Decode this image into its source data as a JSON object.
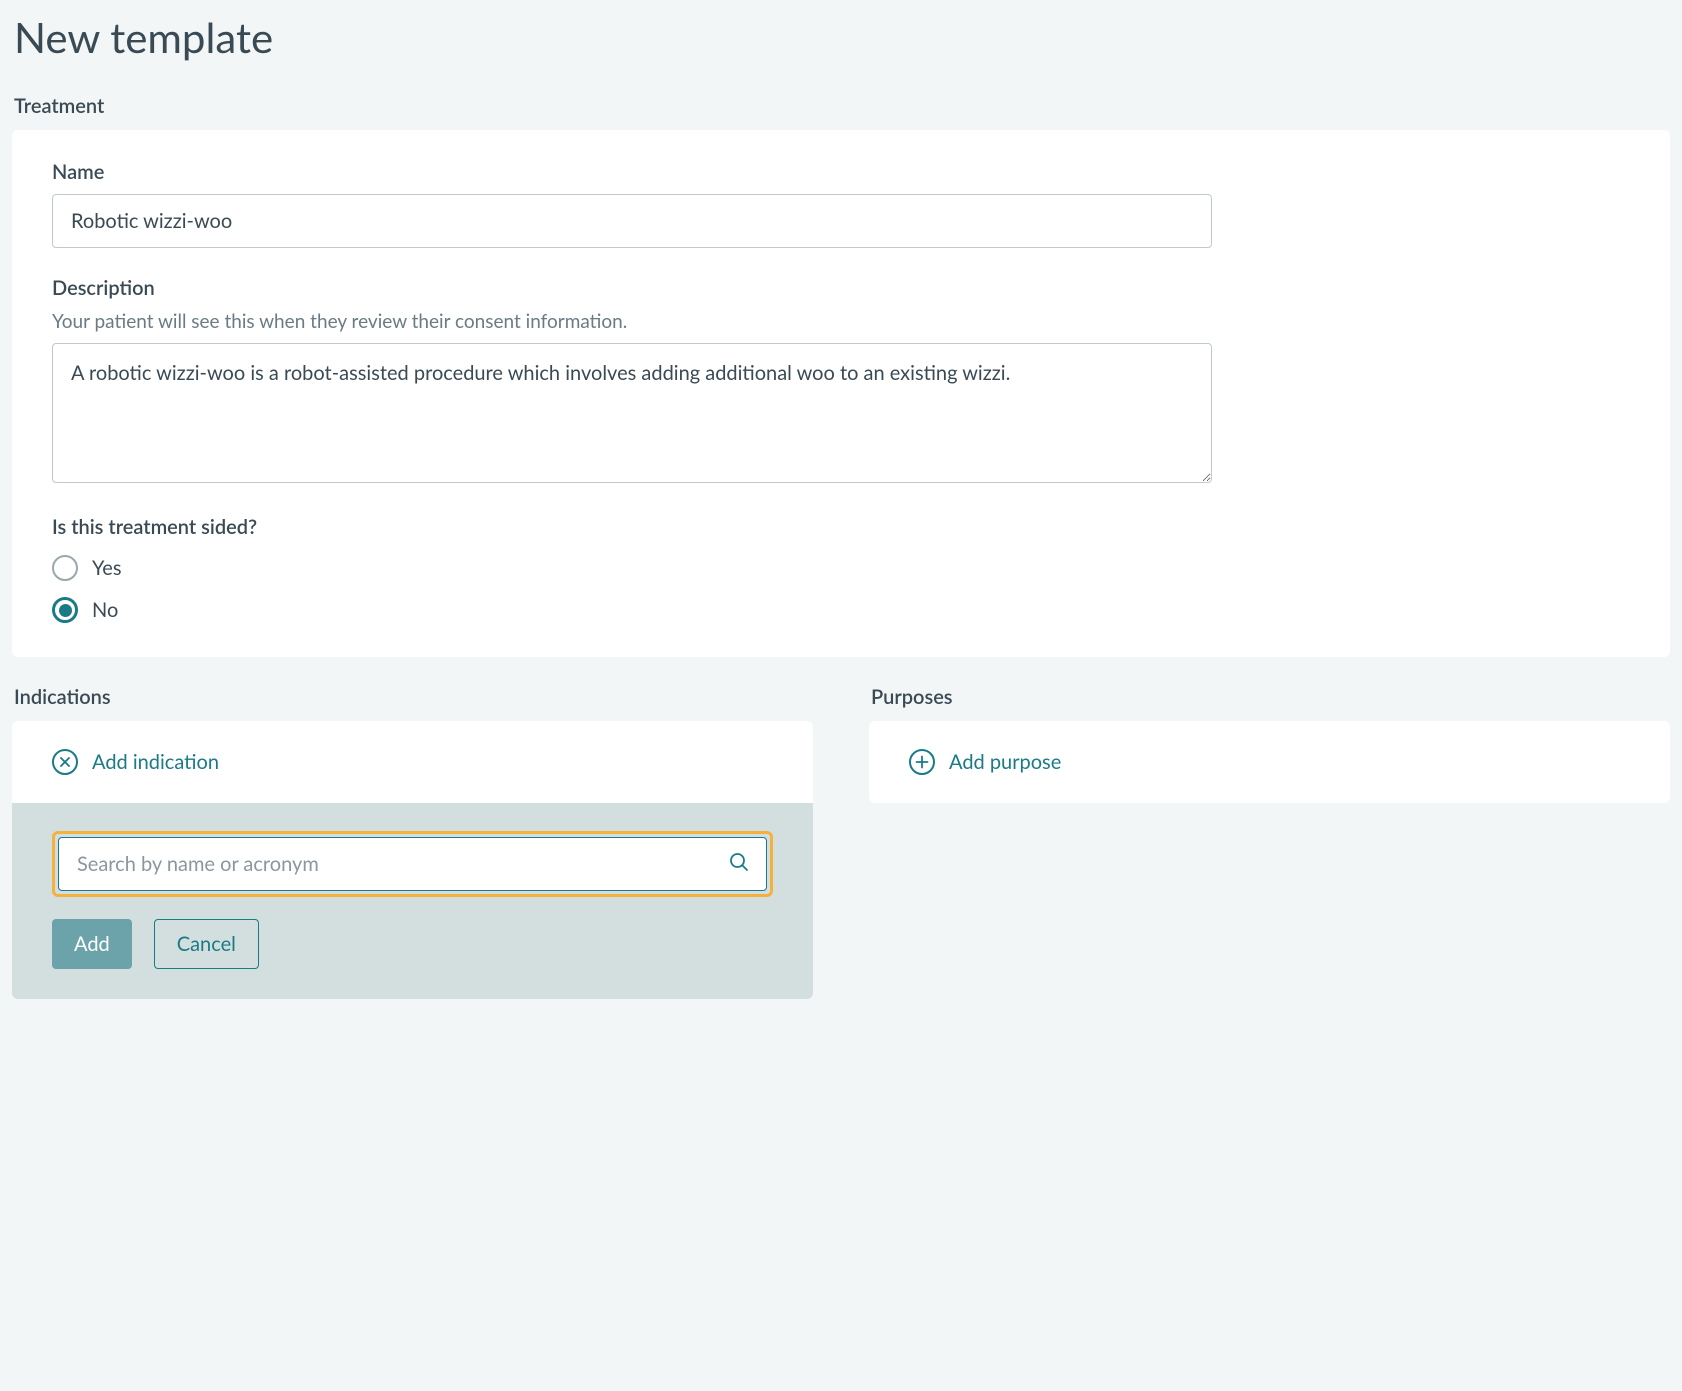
{
  "page": {
    "title": "New template"
  },
  "treatment": {
    "section_label": "Treatment",
    "name": {
      "label": "Name",
      "value": "Robotic wizzi-woo"
    },
    "description": {
      "label": "Description",
      "hint": "Your patient will see this when they review their consent information.",
      "value": "A robotic wizzi-woo is a robot-assisted procedure which involves adding additional woo to an existing wizzi."
    },
    "sided": {
      "label": "Is this treatment sided?",
      "options": {
        "yes": "Yes",
        "no": "No"
      },
      "selected": "no"
    }
  },
  "indications": {
    "section_label": "Indications",
    "add_label": "Add indication",
    "search": {
      "placeholder": "Search by name or acronym",
      "value": ""
    },
    "buttons": {
      "add": "Add",
      "cancel": "Cancel"
    }
  },
  "purposes": {
    "section_label": "Purposes",
    "add_label": "Add purpose"
  }
}
